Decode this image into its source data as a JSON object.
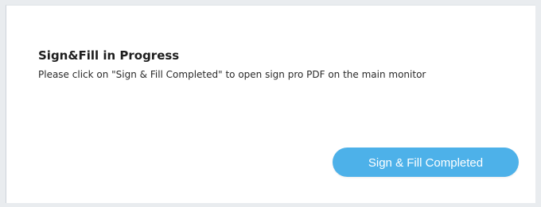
{
  "dialog": {
    "title": "Sign&Fill in Progress",
    "message": "Please click on \"Sign & Fill Completed\" to open sign pro PDF on the main monitor",
    "complete_button_label": "Sign & Fill Completed"
  },
  "colors": {
    "button_background": "#4db1e9",
    "button_text": "#ffffff",
    "window_background": "#ffffff",
    "page_background": "#e9ecef"
  }
}
